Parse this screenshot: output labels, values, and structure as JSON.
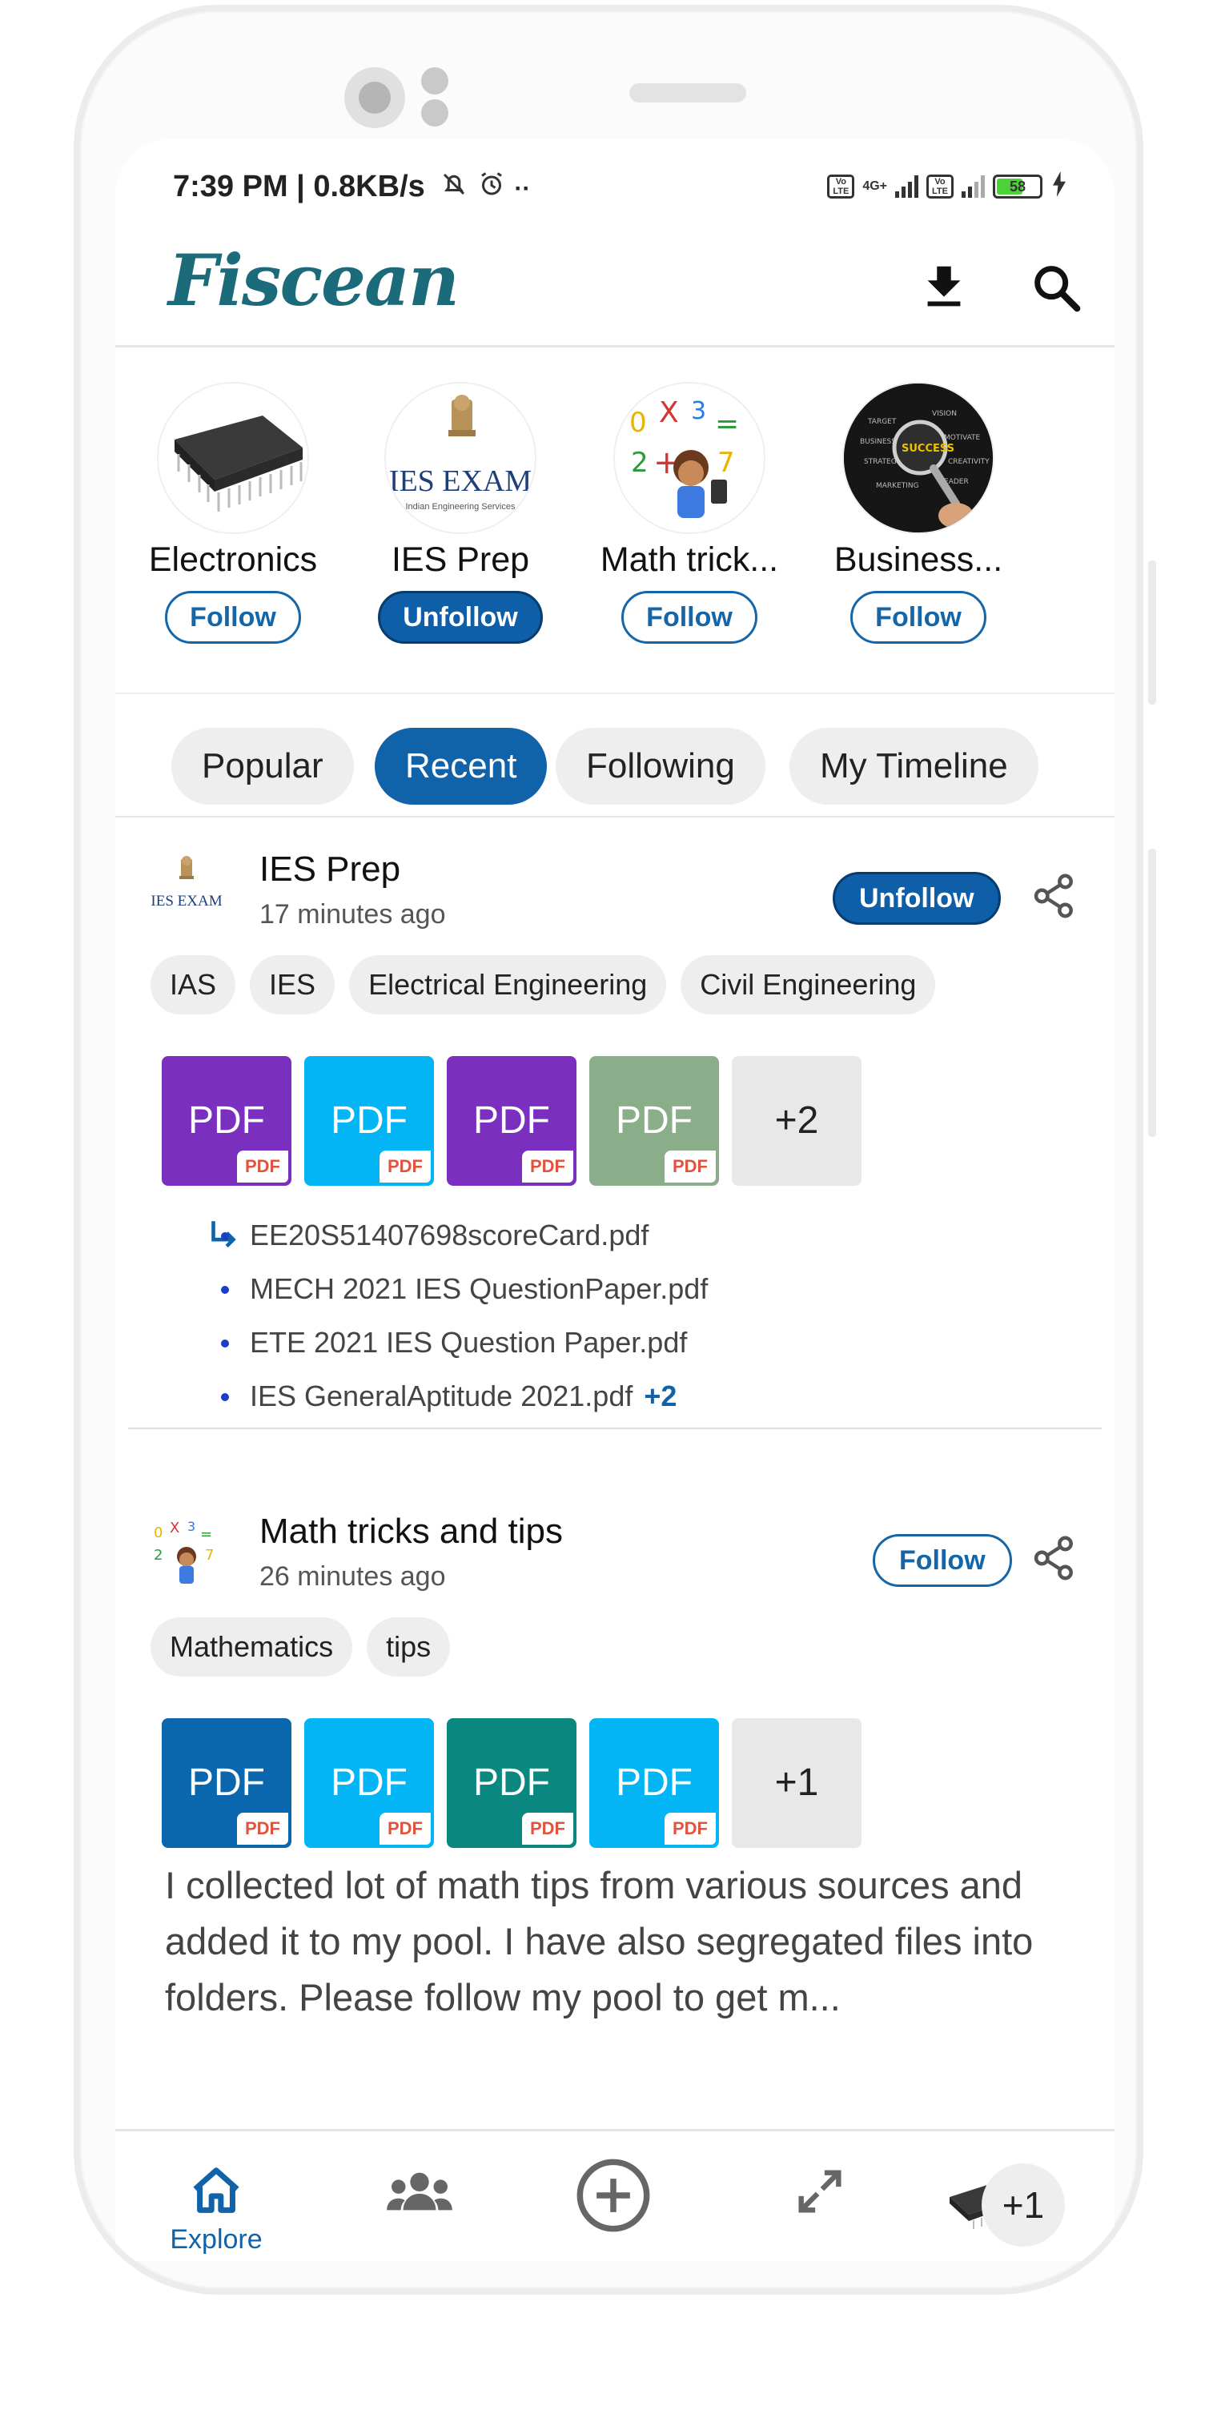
{
  "status_bar": {
    "time": "7:39 PM | 0.8KB/s",
    "volte1": "Vo LTE",
    "net": "4G+",
    "volte2": "Vo LTE",
    "battery": "58"
  },
  "header": {
    "logo": "Fiscean",
    "download_icon": "download-icon",
    "search_icon": "search-icon"
  },
  "pools": [
    {
      "name": "Electronics",
      "button": "Follow",
      "following": false
    },
    {
      "name": "IES Prep",
      "button": "Unfollow",
      "following": true,
      "avatar_text": "IES EXAM",
      "avatar_sub": "Indian Engineering Services"
    },
    {
      "name": "Math trick...",
      "button": "Follow",
      "following": false
    },
    {
      "name": "Business...",
      "button": "Follow",
      "following": false
    }
  ],
  "tabs": [
    {
      "label": "Popular",
      "active": false
    },
    {
      "label": "Recent",
      "active": true
    },
    {
      "label": "Following",
      "active": false
    },
    {
      "label": "My Timeline",
      "active": false
    }
  ],
  "posts": [
    {
      "pool": "IES Prep",
      "time": "17 minutes ago",
      "button": "Unfollow",
      "avatar_text": "IES EXAM",
      "tags": [
        "IAS",
        "IES",
        "Electrical Engineering",
        "Civil Engineering"
      ],
      "files": [
        {
          "label": "PDF",
          "badge": "PDF",
          "color": "#7b2fbf"
        },
        {
          "label": "PDF",
          "badge": "PDF",
          "color": "#03b5f5"
        },
        {
          "label": "PDF",
          "badge": "PDF",
          "color": "#7b2fbf"
        },
        {
          "label": "PDF",
          "badge": "PDF",
          "color": "#8aad8a"
        }
      ],
      "more": "+2",
      "file_names": [
        "EE20S51407698scoreCard.pdf",
        "MECH 2021 IES QuestionPaper.pdf",
        "ETE 2021 IES Question Paper.pdf",
        "IES GeneralAptitude 2021.pdf"
      ],
      "names_more": "+2"
    },
    {
      "pool": "Math tricks and tips",
      "time": "26 minutes ago",
      "button": "Follow",
      "tags": [
        "Mathematics",
        "tips"
      ],
      "files": [
        {
          "label": "PDF",
          "badge": "PDF",
          "color": "#0a67ad"
        },
        {
          "label": "PDF",
          "badge": "PDF",
          "color": "#03b5f5"
        },
        {
          "label": "PDF",
          "badge": "PDF",
          "color": "#0a877f"
        },
        {
          "label": "PDF",
          "badge": "PDF",
          "color": "#03b5f5"
        }
      ],
      "more": "+1",
      "description": "I collected lot of math tips from various sources and added it to my pool. I have also segregated files into folders. Please follow my pool to get m..."
    }
  ],
  "bottom_nav": {
    "explore_label": "Explore",
    "icons": [
      "home-icon",
      "people-icon",
      "add-circle-icon",
      "expand-icon",
      "chip-avatar"
    ],
    "more_count": "+1"
  }
}
